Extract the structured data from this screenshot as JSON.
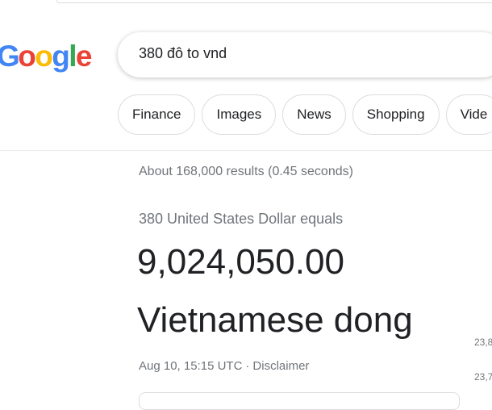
{
  "logo": {
    "letters": [
      {
        "ch": "o",
        "color": "#ea4335"
      },
      {
        "ch": "o",
        "color": "#fbbc05"
      },
      {
        "ch": "g",
        "color": "#4285f4"
      },
      {
        "ch": "l",
        "color": "#34a853"
      },
      {
        "ch": "e",
        "color": "#ea4335"
      }
    ],
    "partial_first": {
      "ch": "G",
      "color": "#4285f4"
    }
  },
  "search": {
    "query": "380 đô to vnd"
  },
  "chips": [
    "Finance",
    "Images",
    "News",
    "Shopping",
    "Vide"
  ],
  "results": {
    "stats": "About 168,000 results (0.45 seconds)"
  },
  "converter": {
    "equals_text": "380 United States Dollar equals",
    "amount": "9,024,050.00",
    "currency": "Vietnamese dong",
    "timestamp": "Aug 10, 15:15 UTC",
    "separator": "·",
    "disclaimer": "Disclaimer"
  },
  "side_values": [
    "23,8",
    "23,7"
  ]
}
